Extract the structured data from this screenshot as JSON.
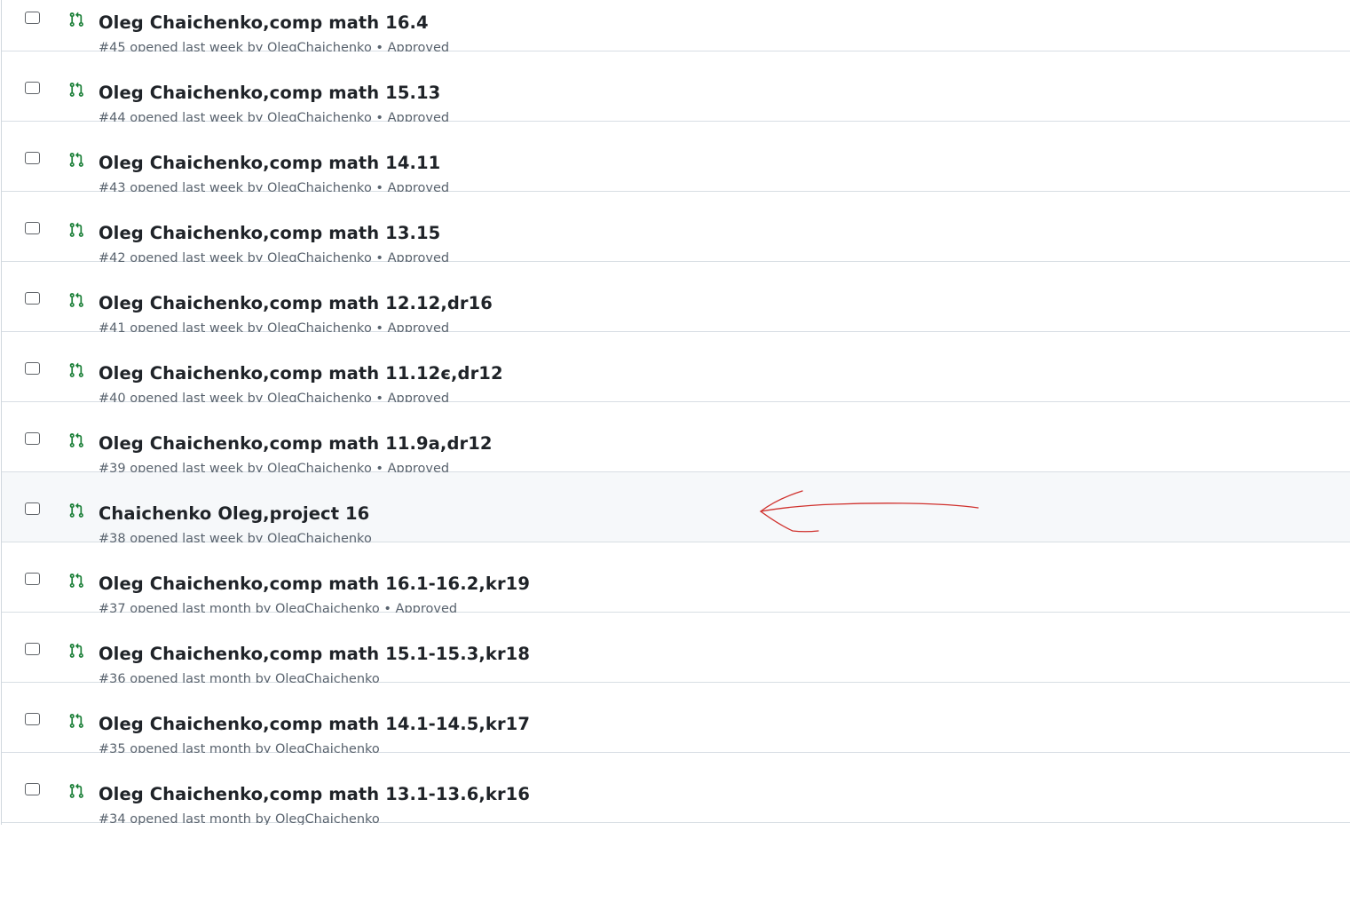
{
  "pull_requests": [
    {
      "title": "Oleg Chaichenko,comp math 16.4",
      "meta": "#45 opened last week by OlegChaichenko • Approved"
    },
    {
      "title": "Oleg Chaichenko,comp math 15.13",
      "meta": "#44 opened last week by OlegChaichenko • Approved"
    },
    {
      "title": "Oleg Chaichenko,comp math 14.11",
      "meta": "#43 opened last week by OlegChaichenko • Approved"
    },
    {
      "title": "Oleg Chaichenko,comp math 13.15",
      "meta": "#42 opened last week by OlegChaichenko • Approved"
    },
    {
      "title": "Oleg Chaichenko,comp math 12.12,dr16",
      "meta": "#41 opened last week by OlegChaichenko • Approved"
    },
    {
      "title": "Oleg Chaichenko,comp math 11.12є,dr12",
      "meta": "#40 opened last week by OlegChaichenko • Approved"
    },
    {
      "title": "Oleg Chaichenko,comp math 11.9a,dr12",
      "meta": "#39 opened last week by OlegChaichenko • Approved"
    },
    {
      "title": "Chaichenko Oleg,project 16",
      "meta": "#38 opened last week by OlegChaichenko"
    },
    {
      "title": "Oleg Chaichenko,comp math 16.1-16.2,kr19",
      "meta": "#37 opened last month by OlegChaichenko • Approved"
    },
    {
      "title": "Oleg Chaichenko,comp math 15.1-15.3,kr18",
      "meta": "#36 opened last month by OlegChaichenko"
    },
    {
      "title": "Oleg Chaichenko,comp math 14.1-14.5,kr17",
      "meta": "#35 opened last month by OlegChaichenko"
    },
    {
      "title": "Oleg Chaichenko,comp math 13.1-13.6,kr16",
      "meta": "#34 opened last month by OlegChaichenko"
    }
  ],
  "colors": {
    "open_pr_icon": "#1a7f37",
    "annotation_arrow": "#d0312d",
    "highlight_row": "#f6f8fa"
  },
  "icons": {
    "pr": "git-pull-request-icon",
    "annotation": "red-arrow-annotation"
  }
}
